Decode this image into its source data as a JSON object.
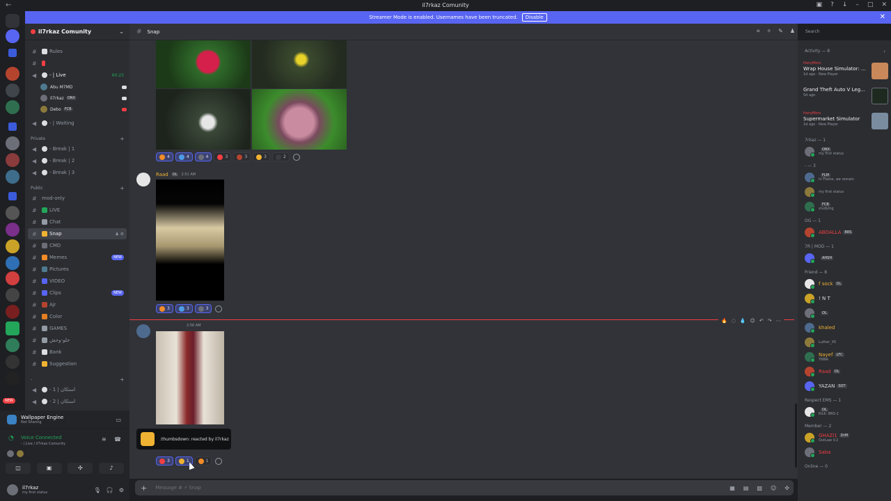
{
  "window": {
    "title": "il7rkaz Comunity"
  },
  "banner": {
    "text": "Streamer Mode is enabled. Usernames have been truncated.",
    "disable_label": "Disable"
  },
  "guild": {
    "name": "il7rkaz Comunity"
  },
  "sidebar": {
    "channels_top": [
      {
        "label": "Rules",
        "type": "text"
      },
      {
        "label": "",
        "type": "text"
      }
    ],
    "live_channel": {
      "label": "- | Live",
      "timer": "60:23"
    },
    "voice_users": [
      {
        "name": "Abu M7MD",
        "tag": ""
      },
      {
        "name": "il7rkaz",
        "tag": "ONX"
      },
      {
        "name": "Debo",
        "tag": "FCB"
      }
    ],
    "waiting_channel": "- | Waiting",
    "categories": {
      "private": "Private",
      "public": "Public"
    },
    "private_channels": [
      "- Break | 1",
      "- Break | 2",
      "- Break | 3"
    ],
    "public_channels": [
      {
        "label": "mod-only",
        "badge": ""
      },
      {
        "label": "LIVE",
        "badge": ""
      },
      {
        "label": "Chat",
        "badge": ""
      },
      {
        "label": "Snap",
        "badge": "",
        "active": true
      },
      {
        "label": "CMD",
        "badge": ""
      },
      {
        "label": "Memes",
        "badge": "NEW"
      },
      {
        "label": "Pictures",
        "badge": ""
      },
      {
        "label": "VIDEO",
        "badge": ""
      },
      {
        "label": "Clips",
        "badge": "NEW"
      },
      {
        "label": "Ajr",
        "badge": ""
      },
      {
        "label": "Color",
        "badge": ""
      },
      {
        "label": "GAMES",
        "badge": ""
      },
      {
        "label": "حلو-وحش",
        "badge": ""
      },
      {
        "label": "Bank",
        "badge": ""
      },
      {
        "label": "Suggestion",
        "badge": ""
      }
    ],
    "voice_category": "- ",
    "bottom_voice": [
      "- 1 | استكان",
      "- 2 | استكان"
    ],
    "new_badge": "NEW"
  },
  "app_panel": {
    "title": "Wallpaper Engine",
    "status": "Not Sharing"
  },
  "voice_panel": {
    "status": "Voice Connected",
    "location": "- | Live / il7rkaz Comunity"
  },
  "user": {
    "name": "il7rkaz",
    "status": "my first status"
  },
  "chat": {
    "channel_name": "Snap",
    "search_placeholder": "Search",
    "messages": [
      {
        "author": "",
        "reactions": [
          {
            "emoji": "fire",
            "count": "4",
            "me": true
          },
          {
            "emoji": "drop",
            "count": "4",
            "me": true
          },
          {
            "emoji": "dots",
            "count": "4",
            "me": true
          },
          {
            "emoji": "heart",
            "count": "3",
            "me": false
          },
          {
            "emoji": "eyes",
            "count": "3",
            "me": false
          },
          {
            "emoji": "sun",
            "count": "3",
            "me": false
          },
          {
            "emoji": "dark",
            "count": "2",
            "me": false
          }
        ]
      },
      {
        "author": "Raad",
        "tag": "OL",
        "time": "2:51 AM",
        "reactions": [
          {
            "emoji": "fire",
            "count": "3",
            "me": true
          },
          {
            "emoji": "drop",
            "count": "3",
            "me": true
          },
          {
            "emoji": "dots",
            "count": "3",
            "me": true
          }
        ]
      },
      {
        "author": "",
        "time": "2:56 AM",
        "reactions": [
          {
            "emoji": "x",
            "count": "3",
            "me": true
          },
          {
            "emoji": "thumbsdown",
            "count": "1",
            "me": true
          },
          {
            "emoji": "fire",
            "count": "1",
            "me": false
          }
        ]
      }
    ],
    "tooltip": ":thumbsdown: reacted by il7rkaz",
    "composer_placeholder": "Message # ⚡ Snap"
  },
  "activity": {
    "title": "Activity — 8",
    "items": [
      {
        "host": "HanyMoro",
        "game": "Wrap House Simulator: Pro...",
        "sub": "1d ago · New Player"
      },
      {
        "host": "",
        "game": "Grand Theft Auto V Legacy",
        "sub": "5d ago"
      },
      {
        "host": "HanyMoro",
        "game": "Supermarket Simulator",
        "sub": "1d ago · New Player"
      }
    ]
  },
  "member_groups": [
    {
      "label": "7rkaz — 1",
      "members": [
        {
          "name": "",
          "tag": "ONX",
          "status": "my first status"
        }
      ]
    },
    {
      "label": "- — 3",
      "members": [
        {
          "name": "",
          "tag": "FLM",
          "status": "In Flame, we remain"
        },
        {
          "name": "",
          "tag": "",
          "status": "my first status"
        },
        {
          "name": "",
          "tag": "FCB",
          "status": "studying"
        }
      ]
    },
    {
      "label": "OG — 1",
      "members": [
        {
          "name": "ABDALLA",
          "tag": "BRS",
          "status": ""
        }
      ]
    },
    {
      "label": "7R | MOD — 1",
      "members": [
        {
          "name": "",
          "tag": "AHSH",
          "status": ""
        }
      ]
    },
    {
      "label": "Friend — 8",
      "members": [
        {
          "name": "f sock",
          "tag": "OL",
          "status": ""
        },
        {
          "name": "! N T",
          "tag": "",
          "status": ""
        },
        {
          "name": "",
          "tag": "OL",
          "status": ""
        },
        {
          "name": "khaled",
          "tag": "",
          "status": ""
        },
        {
          "name": "",
          "tag": "",
          "status": "Luther_X5"
        },
        {
          "name": "Nayef",
          "tag": "LFC",
          "status": "YNNA"
        },
        {
          "name": "Raad",
          "tag": "OL",
          "status": ""
        },
        {
          "name": "YAZAN",
          "tag": "SOT",
          "status": ""
        }
      ]
    },
    {
      "label": "Respect EMS — 1",
      "members": [
        {
          "name": "",
          "tag": "OL",
          "status": "Rick: BRS-1"
        }
      ]
    },
    {
      "label": "Member — 2",
      "members": [
        {
          "name": "GHAZI1",
          "tag": "DrM",
          "status": "OutLaw V.2"
        },
        {
          "name": "Saba",
          "tag": "",
          "status": ""
        }
      ]
    },
    {
      "label": "Online — 0",
      "members": []
    }
  ],
  "colors": {
    "accent": "#5865f2",
    "online": "#23a55a",
    "danger": "#f23f43",
    "gold": "#f0b232"
  }
}
